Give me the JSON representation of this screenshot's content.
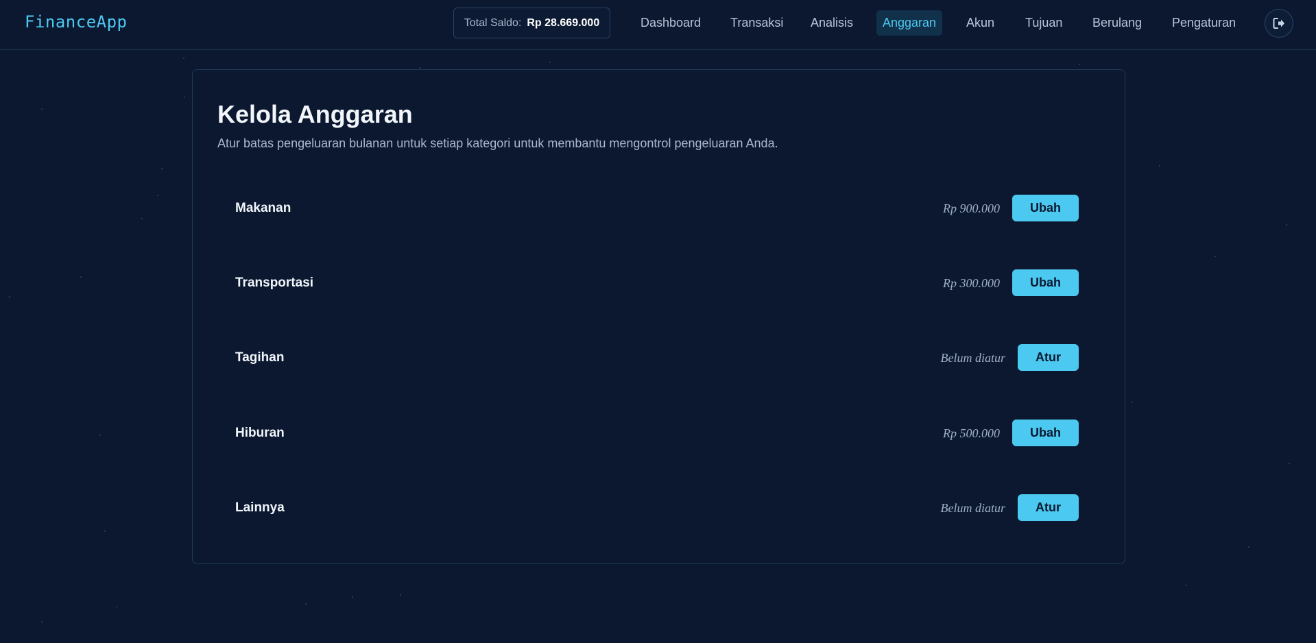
{
  "app": {
    "title": "FinanceApp"
  },
  "header": {
    "saldo_label": "Total Saldo:",
    "saldo_value": "Rp 28.669.000",
    "nav": [
      {
        "label": "Dashboard",
        "active": false
      },
      {
        "label": "Transaksi",
        "active": false
      },
      {
        "label": "Analisis",
        "active": false
      },
      {
        "label": "Anggaran",
        "active": true
      },
      {
        "label": "Akun",
        "active": false
      },
      {
        "label": "Tujuan",
        "active": false
      },
      {
        "label": "Berulang",
        "active": false
      },
      {
        "label": "Pengaturan",
        "active": false
      }
    ],
    "logout_icon": "logout-icon"
  },
  "page": {
    "title": "Kelola Anggaran",
    "subtitle": "Atur batas pengeluaran bulanan untuk setiap kategori untuk membantu mengontrol pengeluaran Anda."
  },
  "budgets": [
    {
      "category": "Makanan",
      "amount": "Rp 900.000",
      "button": "Ubah"
    },
    {
      "category": "Transportasi",
      "amount": "Rp 300.000",
      "button": "Ubah"
    },
    {
      "category": "Tagihan",
      "amount": "Belum diatur",
      "button": "Atur"
    },
    {
      "category": "Hiburan",
      "amount": "Rp 500.000",
      "button": "Ubah"
    },
    {
      "category": "Lainnya",
      "amount": "Belum diatur",
      "button": "Atur"
    }
  ],
  "colors": {
    "background": "#0b1830",
    "accent": "#4cc9f0",
    "text": "#f2f6fb",
    "muted": "#aab8cc"
  }
}
